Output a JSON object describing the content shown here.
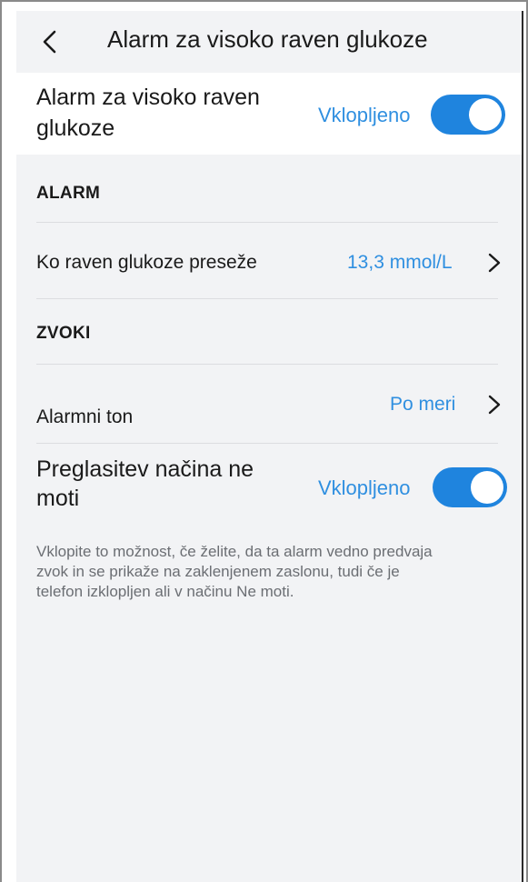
{
  "header": {
    "title": "Alarm za visoko raven glukoze"
  },
  "main_toggle": {
    "label": "Alarm za visoko raven glukoze",
    "status": "Vklopljeno",
    "on": true
  },
  "alarm_section": {
    "heading": "ALARM",
    "threshold_label": "Ko raven glukoze preseže",
    "threshold_value": "13,3 mmol/L"
  },
  "sounds_section": {
    "heading": "ZVOKI",
    "tone_label": "Alarmni ton",
    "tone_value": "Po meri",
    "dnd_label": "Preglasitev načina ne moti",
    "dnd_status": "Vklopljeno",
    "dnd_on": true,
    "help_text": "Vklopite to možnost, če želite, da ta alarm vedno predvaja zvok in se prikaže na zaklenjenem zaslonu, tudi če je telefon izklopljen ali v načinu Ne moti."
  },
  "colors": {
    "accent": "#1f84de",
    "link": "#2f8fe0",
    "background": "#f2f3f5"
  },
  "icons": {
    "back": "chevron-left-icon",
    "row_chevron": "chevron-right-icon"
  }
}
